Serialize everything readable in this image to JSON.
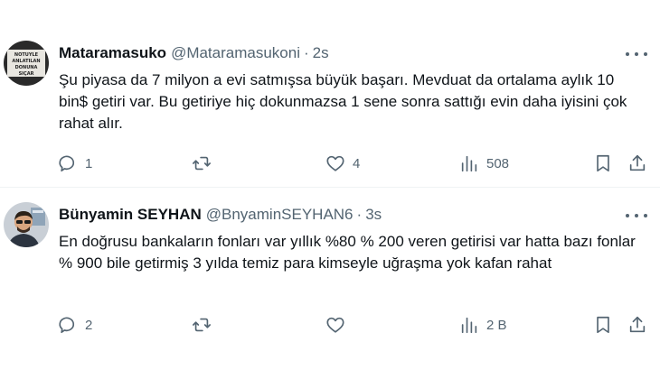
{
  "tweets": [
    {
      "name": "Mataramasuko",
      "handle": "@Mataramasukoni",
      "separator": "·",
      "time": "2s",
      "text": "Şu piyasa da 7 milyon a evi satmışsa büyük başarı. Mevduat da ortalama aylık 10 bin$ getiri var. Bu getiriye hiç dokunmazsa 1 sene sonra sattığı evin daha iyisini çok rahat alır.",
      "avatar_text": [
        "NOTUYLE",
        "ANLATILAN",
        "DONUNA",
        "SIÇAR"
      ],
      "replies": "1",
      "retweets": "",
      "likes": "4",
      "views": "508"
    },
    {
      "name": "Bünyamin SEYHAN",
      "handle": "@BnyaminSEYHAN6",
      "separator": "·",
      "time": "3s",
      "text": "En doğrusu bankaların fonları var yıllık %80 % 200 veren getirisi var hatta bazı fonlar % 900 bile getirmiş 3 yılda temiz para kimseyle uğraşma yok kafan rahat",
      "replies": "2",
      "retweets": "",
      "likes": "",
      "views": "2 B"
    }
  ],
  "colors": {
    "text": "#0f1419",
    "secondary": "#536471",
    "divider": "#eff3f4"
  }
}
